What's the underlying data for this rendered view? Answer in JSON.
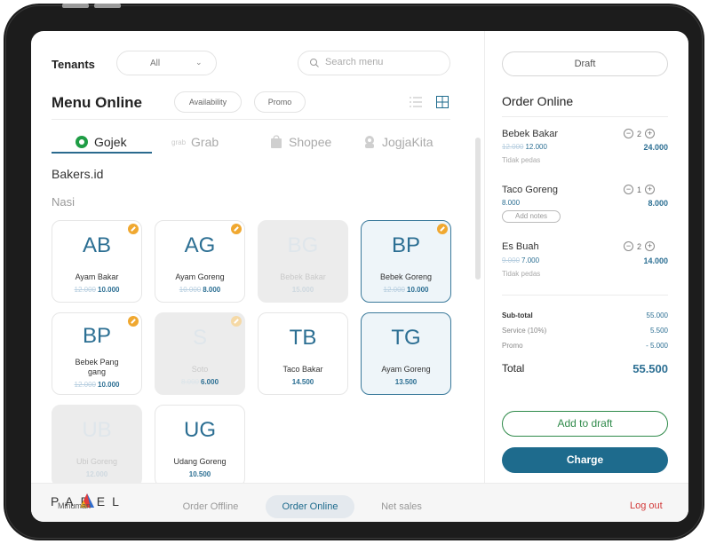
{
  "header": {
    "tenants_label": "Tenants",
    "tenant_value": "All",
    "search_placeholder": "Search menu"
  },
  "menu": {
    "title": "Menu Online",
    "availability_label": "Availability",
    "promo_label": "Promo",
    "tabs": [
      {
        "label": "Gojek",
        "icon": "gojek-icon",
        "active": true
      },
      {
        "label": "Grab",
        "icon": "grab-icon",
        "active": false
      },
      {
        "label": "Shopee",
        "icon": "shopee-icon",
        "active": false
      },
      {
        "label": "JogjaKita",
        "icon": "jogjakita-icon",
        "active": false
      }
    ],
    "store_name": "Bakers.id",
    "category": "Nasi",
    "items": [
      {
        "initials": "AB",
        "name": "Ayam Bakar",
        "old_price": "12.000",
        "price": "10.000",
        "promo": true,
        "state": "normal"
      },
      {
        "initials": "AG",
        "name": "Ayam Goreng",
        "old_price": "10.000",
        "price": "8.000",
        "promo": true,
        "state": "normal"
      },
      {
        "initials": "BG",
        "name": "Bebek Bakar",
        "old_price": "",
        "price": "15.000",
        "promo": false,
        "state": "disabled"
      },
      {
        "initials": "BP",
        "name": "Bebek Goreng",
        "old_price": "12.000",
        "price": "10.000",
        "promo": true,
        "state": "selected"
      },
      {
        "initials": "BP",
        "name": "Bebek Pang gang",
        "old_price": "12.000",
        "price": "10.000",
        "promo": true,
        "state": "normal"
      },
      {
        "initials": "S",
        "name": "Soto",
        "old_price": "8.000",
        "price": "6.000",
        "promo": true,
        "state": "disabled"
      },
      {
        "initials": "TB",
        "name": "Taco Bakar",
        "old_price": "",
        "price": "14.500",
        "promo": false,
        "state": "normal"
      },
      {
        "initials": "TG",
        "name": "Ayam Goreng",
        "old_price": "",
        "price": "13.500",
        "promo": false,
        "state": "selected"
      },
      {
        "initials": "UB",
        "name": "Ubi Goreng",
        "old_price": "",
        "price": "12.000",
        "promo": false,
        "state": "disabled"
      },
      {
        "initials": "UG",
        "name": "Udang Goreng",
        "old_price": "",
        "price": "10.500",
        "promo": false,
        "state": "normal"
      }
    ]
  },
  "order": {
    "draft_label": "Draft",
    "title": "Order Online",
    "items": [
      {
        "name": "Bebek Bakar",
        "old_price": "12.000",
        "price": "12.000",
        "qty": "2",
        "total": "24.000",
        "note": "Tidak pedas"
      },
      {
        "name": "Taco Goreng",
        "old_price": "",
        "price": "8.000",
        "qty": "1",
        "total": "8.000",
        "note_button": "Add notes"
      },
      {
        "name": "Es Buah",
        "old_price": "9.000",
        "price": "7.000",
        "qty": "2",
        "total": "14.000",
        "note": "Tidak pedas"
      }
    ],
    "subtotal_label": "Sub-total",
    "subtotal_value": "55.000",
    "service_label": "Service (10%)",
    "service_value": "5.500",
    "promo_label": "Promo",
    "promo_value": "- 5.000",
    "total_label": "Total",
    "total_value": "55.500",
    "add_to_draft_label": "Add to draft",
    "charge_label": "Charge"
  },
  "bottom_nav": {
    "logo_text": "PAREL",
    "logo_sub": "Minuman",
    "items": [
      {
        "label": "Order Offline",
        "active": false
      },
      {
        "label": "Order Online",
        "active": true
      },
      {
        "label": "Net sales",
        "active": false
      }
    ],
    "logout_label": "Log out"
  },
  "colors": {
    "primary": "#1e6b8d",
    "accent_green": "#2f8a4a",
    "promo_badge": "#f0a830",
    "danger": "#d23a3a"
  }
}
